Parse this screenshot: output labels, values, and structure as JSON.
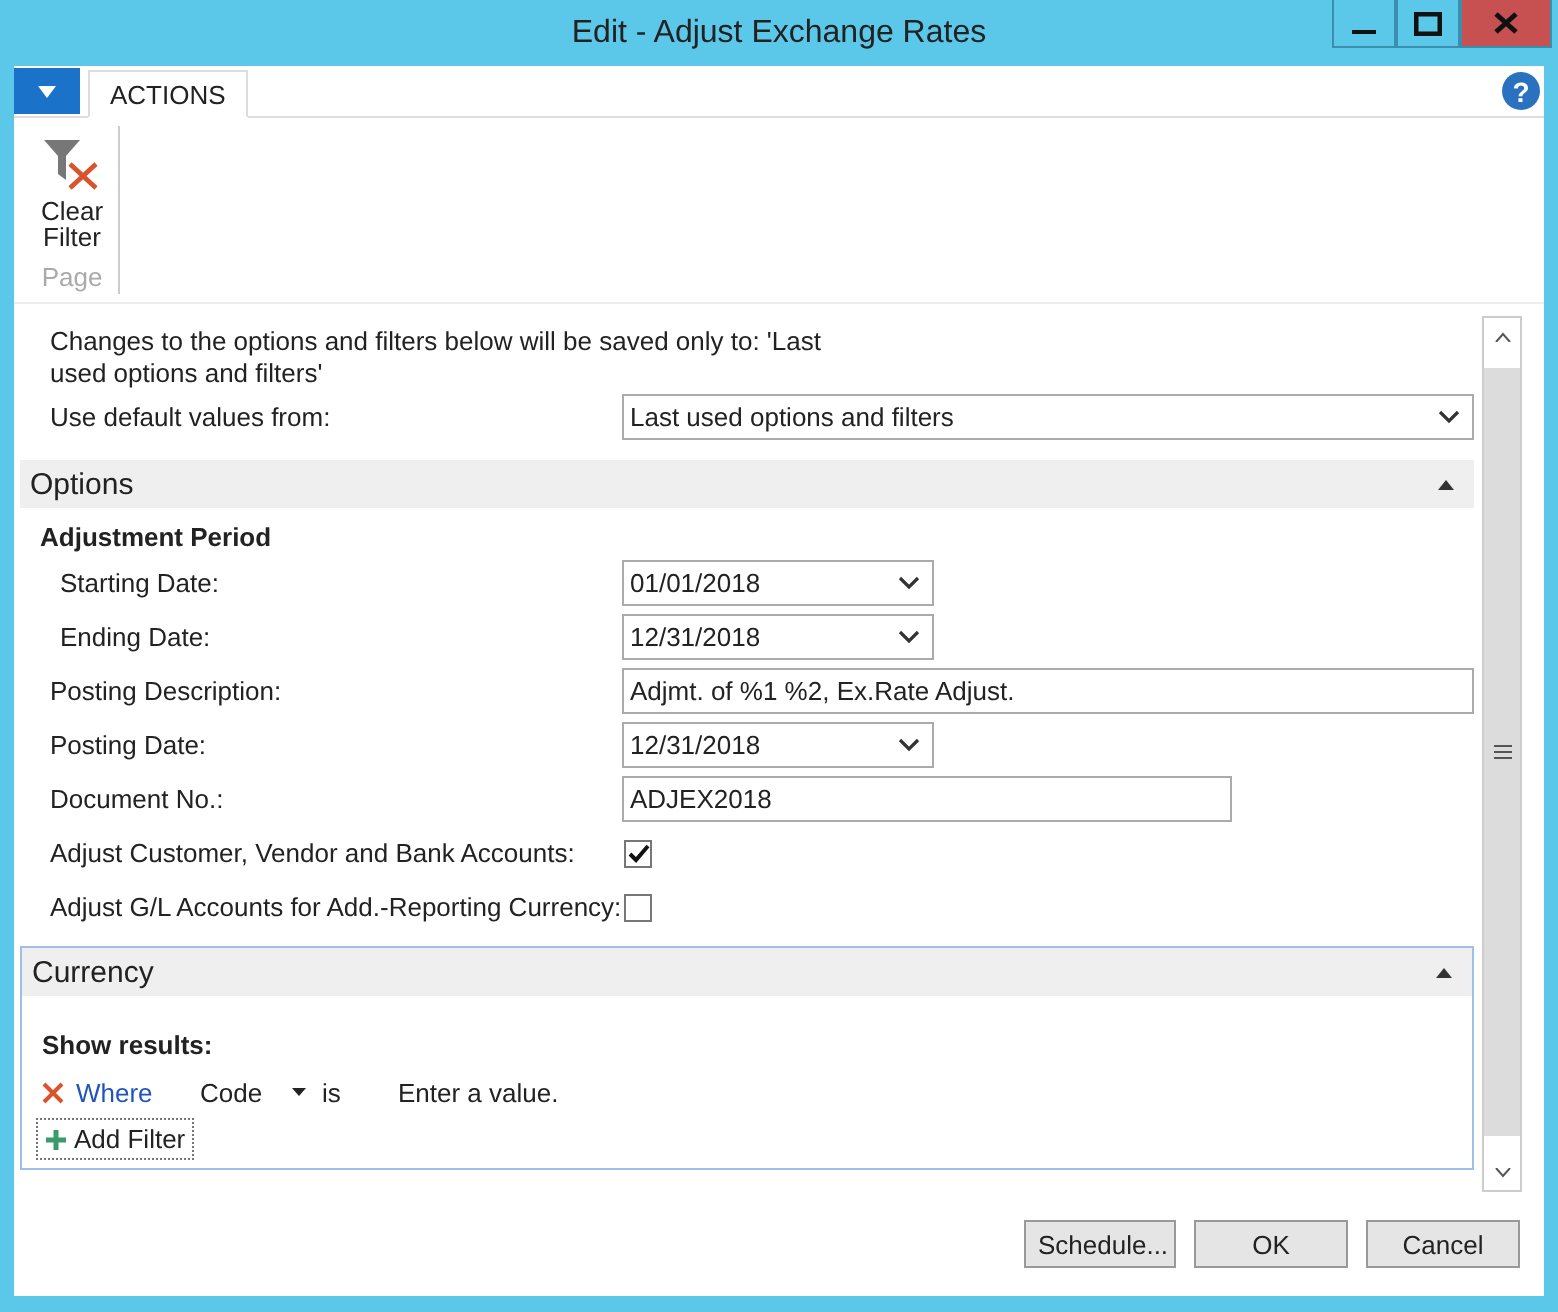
{
  "window": {
    "title": "Edit - Adjust Exchange Rates"
  },
  "help": "?",
  "ribbon": {
    "tabs": [
      {
        "label": "ACTIONS",
        "selected": true
      }
    ],
    "actions": [
      {
        "label": "Clear Filter"
      }
    ],
    "group": "Page"
  },
  "notice": "Changes to the options and filters below will be saved only to: 'Last used options and filters'",
  "default_values": {
    "label": "Use default values from:",
    "value": "Last used options and filters"
  },
  "options": {
    "title": "Options",
    "expanded": true,
    "subheading": "Adjustment Period",
    "fields": [
      {
        "kind": "date",
        "label": "Starting Date:",
        "indented": true,
        "value": "01/01/2018"
      },
      {
        "kind": "date",
        "label": "Ending Date:",
        "indented": true,
        "value": "12/31/2018"
      },
      {
        "kind": "wide",
        "label": "Posting Description:",
        "indented": false,
        "value": "Adjmt. of %1 %2, Ex.Rate Adjust."
      },
      {
        "kind": "date",
        "label": "Posting Date:",
        "indented": false,
        "value": "12/31/2018"
      },
      {
        "kind": "text",
        "label": "Document No.:",
        "indented": false,
        "value": "ADJEX2018"
      },
      {
        "kind": "checkbox",
        "label": "Adjust Customer, Vendor and Bank Accounts:",
        "indented": false,
        "checked": true
      },
      {
        "kind": "checkbox",
        "label": "Adjust G/L Accounts for Add.-Reporting Currency:",
        "indented": false,
        "checked": false
      }
    ]
  },
  "currency": {
    "title": "Currency",
    "expanded": true,
    "show_results": "Show results:",
    "filters": [
      {
        "where": "Where",
        "field": "Code",
        "operator": "is",
        "placeholder": "Enter a value."
      }
    ],
    "add_filter": "Add Filter"
  },
  "buttons": [
    "Schedule...",
    "OK",
    "Cancel"
  ]
}
